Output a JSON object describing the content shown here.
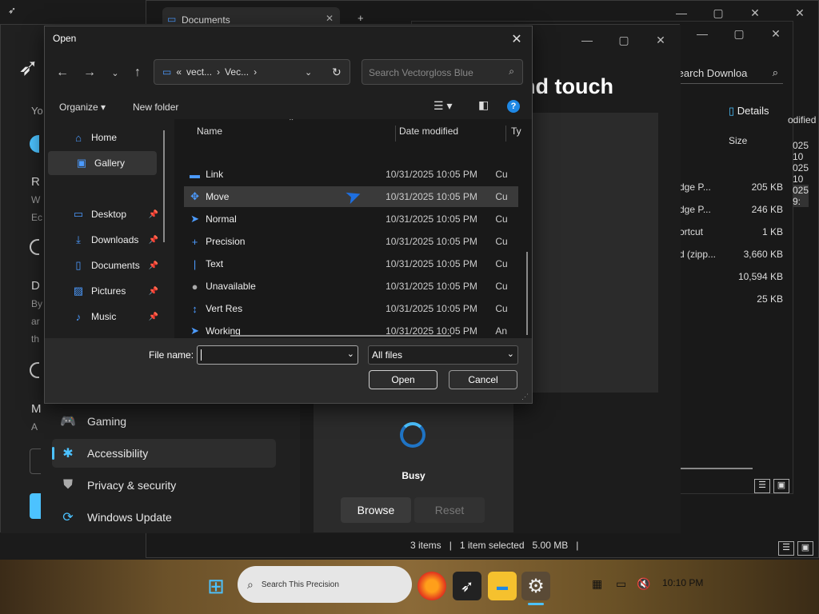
{
  "explorer_back": {
    "tab_title": "Documents",
    "search_placeholder": "Search Downloa",
    "details_label": "Details",
    "col_size": "Size",
    "col_modified_partial": "odified",
    "dates": [
      "025 10",
      "025 10",
      "025 9:"
    ],
    "rows": [
      {
        "name": "dge P...",
        "size": "205 KB"
      },
      {
        "name": "dge P...",
        "size": "246 KB"
      },
      {
        "name": "ortcut",
        "size": "1 KB"
      },
      {
        "name": "d (zipp...",
        "size": "3,660 KB"
      },
      {
        "name": "",
        "size": "10,594 KB"
      },
      {
        "name": "",
        "size": "25 KB"
      }
    ],
    "status": {
      "items": "3 items",
      "selected": "1 item selected",
      "size": "5.00 MB"
    }
  },
  "settings": {
    "heading_partial": "nd touch",
    "nav": [
      {
        "label": "Gaming",
        "icon": "gamepad-icon"
      },
      {
        "label": "Accessibility",
        "icon": "accessibility-icon",
        "active": true
      },
      {
        "label": "Privacy & security",
        "icon": "shield-icon"
      },
      {
        "label": "Windows Update",
        "icon": "update-icon"
      }
    ],
    "busy_label": "Busy",
    "browse_label": "Browse",
    "reset_label": "Reset",
    "side_letters": [
      "Yo",
      "R",
      "W",
      "Ec",
      "D",
      "By",
      "ar",
      "th",
      "M",
      "A"
    ]
  },
  "open_dialog": {
    "title": "Open",
    "breadcrumb": [
      "vect...",
      "Vec..."
    ],
    "breadcrumb_prefix": "«",
    "search_placeholder": "Search Vectorgloss Blue",
    "organize_label": "Organize",
    "new_folder_label": "New folder",
    "nav": [
      {
        "label": "Home",
        "icon": "home-icon"
      },
      {
        "label": "Gallery",
        "icon": "gallery-icon",
        "selected": true
      },
      {
        "label": "Desktop",
        "icon": "desktop-icon",
        "pinned": true
      },
      {
        "label": "Downloads",
        "icon": "download-icon",
        "pinned": true
      },
      {
        "label": "Documents",
        "icon": "document-icon",
        "pinned": true
      },
      {
        "label": "Pictures",
        "icon": "picture-icon",
        "pinned": true
      },
      {
        "label": "Music",
        "icon": "music-icon",
        "pinned": true
      }
    ],
    "columns": {
      "name": "Name",
      "date": "Date modified",
      "type": "Ty"
    },
    "files": [
      {
        "name": "Link",
        "date": "10/31/2025 10:05 PM",
        "type": "Cu",
        "icon": "link-cursor-icon"
      },
      {
        "name": "Move",
        "date": "10/31/2025 10:05 PM",
        "type": "Cu",
        "icon": "move-cursor-icon",
        "selected": true
      },
      {
        "name": "Normal",
        "date": "10/31/2025 10:05 PM",
        "type": "Cu",
        "icon": "normal-cursor-icon"
      },
      {
        "name": "Precision",
        "date": "10/31/2025 10:05 PM",
        "type": "Cu",
        "icon": "precision-cursor-icon"
      },
      {
        "name": "Text",
        "date": "10/31/2025 10:05 PM",
        "type": "Cu",
        "icon": "text-cursor-icon"
      },
      {
        "name": "Unavailable",
        "date": "10/31/2025 10:05 PM",
        "type": "Cu",
        "icon": "unavailable-cursor-icon"
      },
      {
        "name": "Vert Res",
        "date": "10/31/2025 10:05 PM",
        "type": "Cu",
        "icon": "vert-resize-cursor-icon"
      },
      {
        "name": "Working",
        "date": "10/31/2025 10:05 PM",
        "type": "An",
        "icon": "working-cursor-icon"
      }
    ],
    "file_name_label": "File name:",
    "file_name_value": "",
    "filter_value": "All files",
    "open_label": "Open",
    "cancel_label": "Cancel"
  },
  "taskbar": {
    "search_placeholder": "Search This Precision",
    "clock": "10:10 PM"
  },
  "colors": {
    "accent": "#4cc2ff",
    "dialog_bg": "#1f1f1f",
    "selection": "#3a3a3a"
  }
}
